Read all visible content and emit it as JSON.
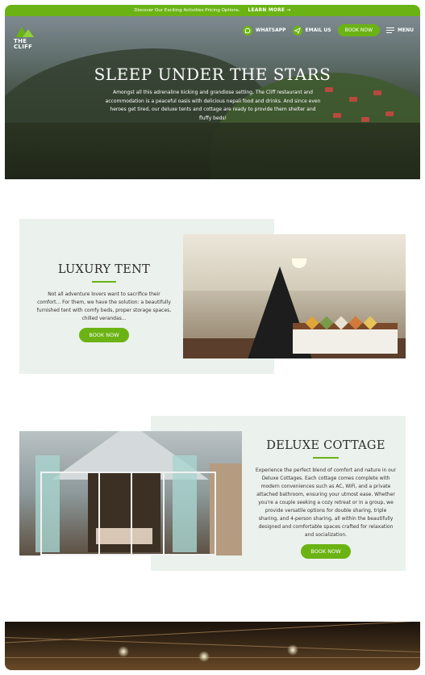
{
  "promo": {
    "text": "Discover Our Exciting Activities Pricing Options.",
    "cta": "LEARN MORE →"
  },
  "brand": {
    "logo_line1": "THE",
    "logo_line2": "CLIFF",
    "accent": "#6bb314"
  },
  "nav": {
    "whatsapp": "WHATSAPP",
    "email": "EMAIL US",
    "book": "BOOK NOW",
    "menu": "MENU"
  },
  "hero": {
    "title": "SLEEP UNDER THE STARS",
    "text": "Amongst all this adrenaline kicking and grandiose setting, The Cliff restaurant and accommodation is a peaceful oasis with delicious nepali food and drinks. And since even heroes get tired, our deluxe tents and cottage are ready to provide them shelter and fluffy beds!"
  },
  "tent": {
    "title": "LUXURY TENT",
    "text": "Not all adventure lovers want to sacrifice their comfort... For them, we have the solution: a beautifully furnished tent with comfy beds, proper storage spaces, chilled verandas...",
    "button": "BOOK NOW"
  },
  "cottage": {
    "title": "DELUXE COTTAGE",
    "text": "Experience the perfect blend of comfort and nature in our Deluxe Cottages. Each cottage comes complete with modern conveniences such as AC, WiFi, and a private attached bathroom, ensuring your utmost ease. Whether you're a couple seeking a cozy retreat or in a group, we provide versatile options for double sharing, triple sharing, and 4-person sharing, all within the beautifully designed and comfortable spaces crafted for relaxation and socialization.",
    "button": "BOOK NOW"
  }
}
